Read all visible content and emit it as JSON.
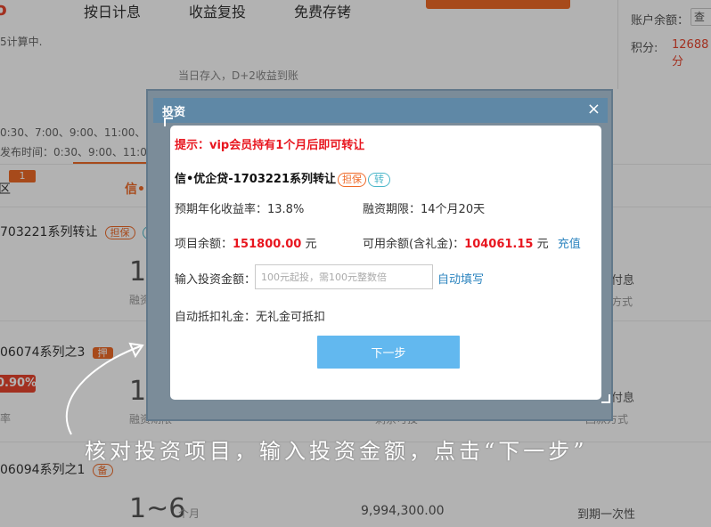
{
  "background": {
    "brand_fragment": "o",
    "nav": [
      "按日计息",
      "收益复投",
      "免费存铐"
    ],
    "calc_note": "5计算中.",
    "account_balance_label": "账户余额：",
    "account_button_label": "查",
    "points_label": "积分:",
    "points_value": "12688分",
    "deposit_note": "当日存入，D+2收益到账",
    "time_line_1": "0:30、7:00、9:00、11:00、13:",
    "time_line_2": "发布时间：0:30、9:00、11:00、13:",
    "tab_badge": "1",
    "tab_fragment": "区",
    "tab_active_fragment": "信•",
    "rows": [
      {
        "title": "703221系列转让",
        "tag1": "担保",
        "tag2": "转",
        "big": "1",
        "label": "融资",
        "right": "付息",
        "right_sub": "方式"
      },
      {
        "title": "06074系列之3",
        "tag1": "押",
        "rate": "0.90%",
        "big": "1",
        "label": "融资期限",
        "middle": "剩余可投",
        "right": "付息",
        "right_sub": "回款方式",
        "left_fragment": "率"
      },
      {
        "title": "06094系列之1",
        "tag1": "备",
        "term_num": "1~6",
        "term_unit": "个月",
        "amount": "9,994,300.00",
        "right": "到期一次性"
      }
    ]
  },
  "modal": {
    "title": "投资",
    "close_label": "×",
    "tip": "提示：vip会员持有1个月后即可转让",
    "product_name": "信•优企贷-1703221系列转让",
    "tag_guarantee": "担保",
    "tag_transfer": "转",
    "rate_label": "预期年化收益率：13.8%",
    "term_label": "融资期限：14个月20天",
    "balance_label": "项目余额：",
    "balance_value": "151800.00",
    "balance_unit": "元",
    "available_label": "可用余额(含礼金)：",
    "available_value": "104061.15",
    "available_unit": "元",
    "recharge_link": "充值",
    "amount_label": "输入投资金额：",
    "amount_placeholder": "100元起投，需100元整数倍",
    "amount_value": "",
    "autofill_link": "自动填写",
    "gift_label": "自动抵扣礼金：无礼金可抵扣",
    "next_button": "下一步"
  },
  "caption": "核对投资项目，输入投资金额，点击“下一步”"
}
